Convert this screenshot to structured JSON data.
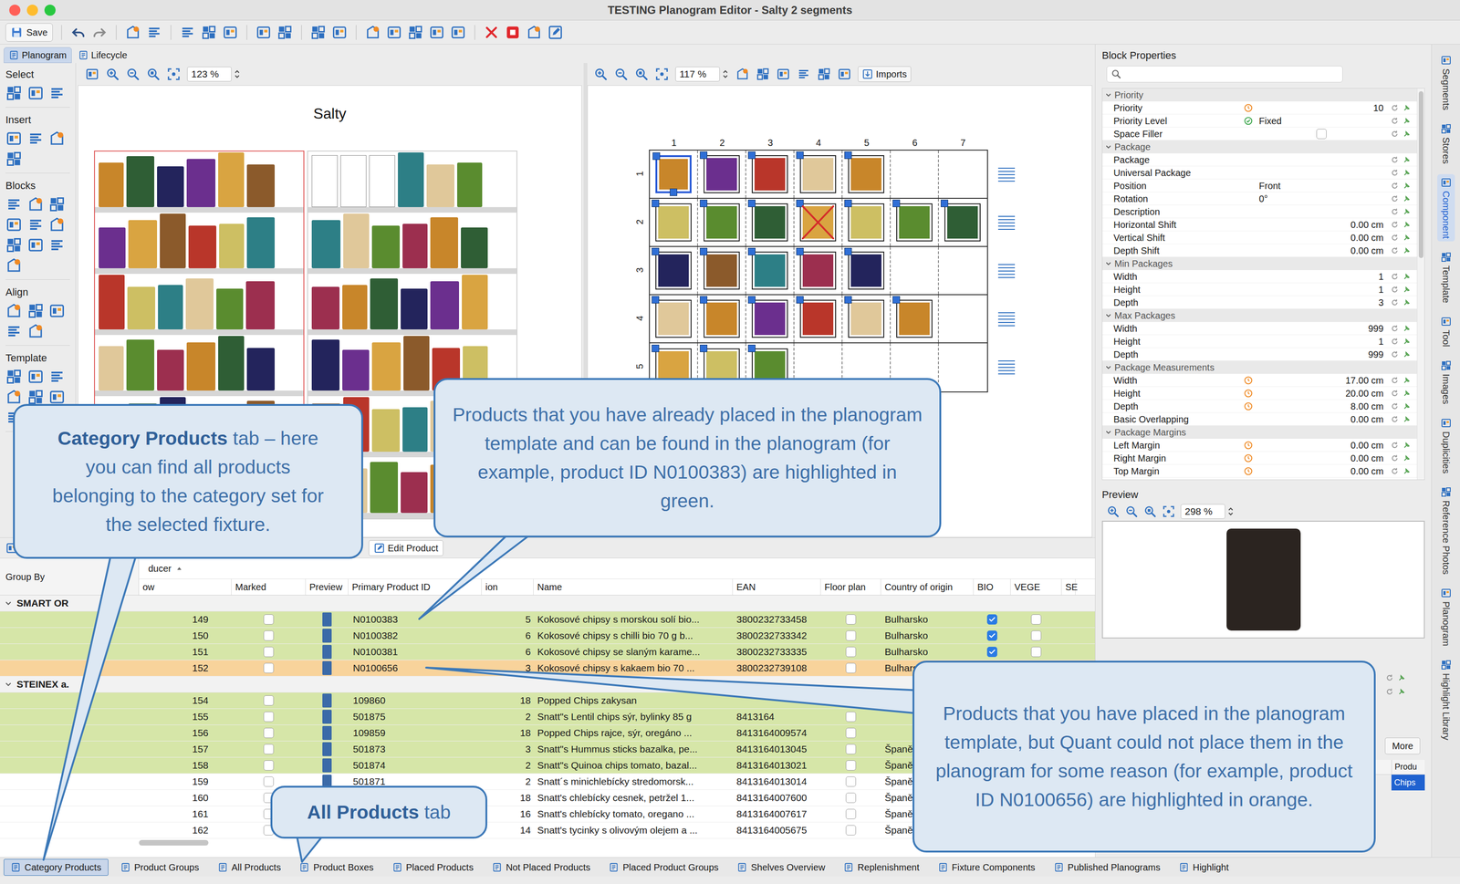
{
  "window": {
    "title": "TESTING Planogram Editor - Salty 2 segments"
  },
  "toolbar": {
    "save": "Save"
  },
  "view_tabs": [
    {
      "label": "Planogram",
      "selected": true
    },
    {
      "label": "Lifecycle",
      "selected": false
    }
  ],
  "palette": [
    "Select",
    "Insert",
    "Blocks",
    "Align",
    "Template"
  ],
  "left_canvas": {
    "zoom": "123 %",
    "title": "Salty"
  },
  "grid_canvas": {
    "zoom": "117 %",
    "imports": "Imports",
    "columns": [
      "1",
      "2",
      "3",
      "4",
      "5",
      "6",
      "7"
    ],
    "rows": [
      {
        "label": "1",
        "cells": [
          {
            "kind": "product",
            "selected": true
          },
          {
            "kind": "product",
            "selected": false
          },
          {
            "kind": "product",
            "selected": false
          },
          {
            "kind": "product",
            "selected": false
          },
          {
            "kind": "product",
            "selected": false
          },
          {
            "kind": "empty",
            "selected": false
          },
          {
            "kind": "empty",
            "selected": false
          }
        ]
      },
      {
        "label": "2",
        "cells": [
          {
            "kind": "product",
            "selected": false
          },
          {
            "kind": "product",
            "selected": false
          },
          {
            "kind": "product",
            "selected": false
          },
          {
            "kind": "crossed",
            "selected": false
          },
          {
            "kind": "product",
            "selected": false
          },
          {
            "kind": "product",
            "selected": false
          },
          {
            "kind": "product",
            "selected": false
          }
        ]
      },
      {
        "label": "3",
        "cells": [
          {
            "kind": "product",
            "selected": false
          },
          {
            "kind": "product",
            "selected": false
          },
          {
            "kind": "product",
            "selected": false
          },
          {
            "kind": "product",
            "selected": false
          },
          {
            "kind": "product",
            "selected": false
          },
          {
            "kind": "empty",
            "selected": false
          },
          {
            "kind": "empty",
            "selected": false
          }
        ]
      },
      {
        "label": "4",
        "cells": [
          {
            "kind": "product",
            "selected": false
          },
          {
            "kind": "product",
            "selected": false
          },
          {
            "kind": "product",
            "selected": false
          },
          {
            "kind": "product",
            "selected": false
          },
          {
            "kind": "product",
            "selected": false
          },
          {
            "kind": "product",
            "selected": false
          },
          {
            "kind": "empty",
            "selected": false
          }
        ]
      },
      {
        "label": "5",
        "cells": [
          {
            "kind": "product",
            "selected": false
          },
          {
            "kind": "product",
            "selected": false
          },
          {
            "kind": "product",
            "selected": false
          },
          {
            "kind": "empty",
            "selected": false
          },
          {
            "kind": "empty",
            "selected": false
          },
          {
            "kind": "empty",
            "selected": false
          },
          {
            "kind": "empty",
            "selected": false
          }
        ]
      }
    ]
  },
  "block_properties": {
    "title": "Block Properties",
    "groups": [
      {
        "label": "Priority",
        "expanded": true,
        "rows": [
          {
            "label": "Priority",
            "kind": "text",
            "value": "10",
            "indicator": "calculated"
          },
          {
            "label": "Priority Level",
            "kind": "text",
            "value": "Fixed",
            "indicator": "fixed"
          },
          {
            "label": "Space Filler",
            "kind": "checkbox",
            "checked": false,
            "indicator": "none"
          }
        ]
      },
      {
        "label": "Package",
        "expanded": true,
        "rows": [
          {
            "label": "Package",
            "kind": "text",
            "value": "",
            "indicator": "none"
          },
          {
            "label": "Universal Package",
            "kind": "text",
            "value": "",
            "indicator": "none"
          },
          {
            "label": "Position",
            "kind": "text",
            "value": "Front",
            "indicator": "none"
          },
          {
            "label": "Rotation",
            "kind": "text",
            "value": "0°",
            "indicator": "none"
          },
          {
            "label": "Description",
            "kind": "text",
            "value": "",
            "indicator": "none"
          },
          {
            "label": "Horizontal Shift",
            "kind": "text",
            "value": "0.00 cm",
            "indicator": "none"
          },
          {
            "label": "Vertical Shift",
            "kind": "text",
            "value": "0.00 cm",
            "indicator": "none"
          },
          {
            "label": "Depth Shift",
            "kind": "text",
            "value": "0.00 cm",
            "indicator": "none"
          }
        ]
      },
      {
        "label": "Min Packages",
        "expanded": true,
        "rows": [
          {
            "label": "Width",
            "kind": "text",
            "value": "1",
            "indicator": "none"
          },
          {
            "label": "Height",
            "kind": "text",
            "value": "1",
            "indicator": "none"
          },
          {
            "label": "Depth",
            "kind": "text",
            "value": "3",
            "indicator": "none"
          }
        ]
      },
      {
        "label": "Max Packages",
        "expanded": true,
        "rows": [
          {
            "label": "Width",
            "kind": "text",
            "value": "999",
            "indicator": "none"
          },
          {
            "label": "Height",
            "kind": "text",
            "value": "1",
            "indicator": "none"
          },
          {
            "label": "Depth",
            "kind": "text",
            "value": "999",
            "indicator": "none"
          }
        ]
      },
      {
        "label": "Package Measurements",
        "expanded": true,
        "rows": [
          {
            "label": "Width",
            "kind": "text",
            "value": "17.00 cm",
            "indicator": "calculated"
          },
          {
            "label": "Height",
            "kind": "text",
            "value": "20.00 cm",
            "indicator": "calculated"
          },
          {
            "label": "Depth",
            "kind": "text",
            "value": "8.00 cm",
            "indicator": "calculated"
          },
          {
            "label": "Basic Overlapping",
            "kind": "text",
            "value": "0.00 cm",
            "indicator": "none"
          }
        ]
      },
      {
        "label": "Package Margins",
        "expanded": true,
        "rows": [
          {
            "label": "Left Margin",
            "kind": "text",
            "value": "0.00 cm",
            "indicator": "calculated"
          },
          {
            "label": "Right Margin",
            "kind": "text",
            "value": "0.00 cm",
            "indicator": "calculated"
          },
          {
            "label": "Top Margin",
            "kind": "text",
            "value": "0.00 cm",
            "indicator": "calculated"
          }
        ]
      }
    ]
  },
  "preview": {
    "title": "Preview",
    "zoom": "298 %"
  },
  "lower_panel": {
    "more": "More",
    "column": "Produ",
    "cell": "Chips",
    "cell_selected": true
  },
  "side_tabs": [
    {
      "label": "Segments",
      "selected": false
    },
    {
      "label": "Stores",
      "selected": false
    },
    {
      "label": "Component",
      "selected": true
    },
    {
      "label": "Template",
      "selected": false
    },
    {
      "label": "Tool",
      "selected": false
    },
    {
      "label": "Images",
      "selected": false
    },
    {
      "label": "Duplicities",
      "selected": false
    },
    {
      "label": "Reference Photos",
      "selected": false
    },
    {
      "label": "Planogram",
      "selected": false
    },
    {
      "label": "Highlight Library",
      "selected": false
    }
  ],
  "table": {
    "edit_button": "Edit Product",
    "group_by": "Group By",
    "sort_column": "ducer",
    "sort_ascending": true,
    "columns": [
      "ow",
      "Marked",
      "Preview",
      "Primary Product ID",
      "ion",
      "Name",
      "EAN",
      "Floor plan",
      "Country of origin",
      "BIO",
      "VEGE",
      "SE"
    ],
    "rows": [
      {
        "kind": "group",
        "label": "SMART OR",
        "expanded": true
      },
      {
        "kind": "item",
        "status": "placed",
        "row": "149",
        "marked": false,
        "primary_id": "N0100383",
        "ion": "5",
        "name": "Kokosové chipsy s morskou solí bio...",
        "ean": "3800232733458",
        "floor_plan": false,
        "country": "Bulharsko",
        "bio": true,
        "vege": false
      },
      {
        "kind": "item",
        "status": "placed",
        "row": "150",
        "marked": false,
        "primary_id": "N0100382",
        "ion": "6",
        "name": "Kokosové chipsy s chilli bio 70 g b...",
        "ean": "3800232733342",
        "floor_plan": false,
        "country": "Bulharsko",
        "bio": true,
        "vege": false
      },
      {
        "kind": "item",
        "status": "placed",
        "row": "151",
        "marked": false,
        "primary_id": "N0100381",
        "ion": "6",
        "name": "Kokosové chipsy se slaným karame...",
        "ean": "3800232733335",
        "floor_plan": false,
        "country": "Bulharsko",
        "bio": true,
        "vege": false
      },
      {
        "kind": "item",
        "status": "not_placed",
        "row": "152",
        "marked": false,
        "primary_id": "N0100656",
        "ion": "3",
        "name": "Kokosové chipsy s kakaem bio 70 ...",
        "ean": "3800232739108",
        "floor_plan": false,
        "country": "Bulhars",
        "bio": true,
        "vege": false
      },
      {
        "kind": "group",
        "label": "STEINEX a.",
        "expanded": true
      },
      {
        "kind": "item",
        "status": "placed",
        "row": "154",
        "marked": false,
        "primary_id": "109860",
        "ion": "18",
        "name": "Popped Chips zakysan",
        "ean": "",
        "floor_plan": false,
        "country": "",
        "bio": false,
        "vege": false
      },
      {
        "kind": "item",
        "status": "placed",
        "row": "155",
        "marked": false,
        "primary_id": "501875",
        "ion": "2",
        "name": "Snatt\"s Lentil chips sýr, bylinky 85 g",
        "ean": "8413164",
        "floor_plan": false,
        "country": "",
        "bio": false,
        "vege": false
      },
      {
        "kind": "item",
        "status": "placed",
        "row": "156",
        "marked": false,
        "primary_id": "109859",
        "ion": "18",
        "name": "Popped Chips rajce, sýr, oregáno ...",
        "ean": "8413164009574",
        "floor_plan": false,
        "country": "",
        "bio": false,
        "vege": false
      },
      {
        "kind": "item",
        "status": "placed",
        "row": "157",
        "marked": false,
        "primary_id": "501873",
        "ion": "3",
        "name": "Snatt\"s Hummus sticks bazalka, pe...",
        "ean": "8413164013045",
        "floor_plan": false,
        "country": "Španěl",
        "bio": false,
        "vege": false
      },
      {
        "kind": "item",
        "status": "placed",
        "row": "158",
        "marked": false,
        "primary_id": "501874",
        "ion": "2",
        "name": "Snatt\"s Quinoa chips tomato, bazal...",
        "ean": "8413164013021",
        "floor_plan": false,
        "country": "Španěl",
        "bio": false,
        "vege": false
      },
      {
        "kind": "item",
        "status": "none",
        "row": "159",
        "marked": false,
        "primary_id": "501871",
        "ion": "2",
        "name": "Snatt´s minichlebícky stredomorsk...",
        "ean": "8413164013014",
        "floor_plan": false,
        "country": "Španěl",
        "bio": false,
        "vege": false
      },
      {
        "kind": "item",
        "status": "none",
        "row": "160",
        "marked": false,
        "primary_id": "",
        "ion": "18",
        "name": "Snatt's chlebícky cesnek, petržel 1...",
        "ean": "8413164007600",
        "floor_plan": false,
        "country": "Španěl",
        "bio": false,
        "vege": false
      },
      {
        "kind": "item",
        "status": "none",
        "row": "161",
        "marked": false,
        "primary_id": "",
        "ion": "16",
        "name": "Snatt's chlebícky tomato, oregano ...",
        "ean": "8413164007617",
        "floor_plan": false,
        "country": "Španěl",
        "bio": false,
        "vege": false
      },
      {
        "kind": "item",
        "status": "none",
        "row": "162",
        "marked": false,
        "primary_id": "",
        "ion": "14",
        "name": "Snatt's tycinky s olivovým olejem a ...",
        "ean": "8413164005675",
        "floor_plan": false,
        "country": "Španěl",
        "bio": false,
        "vege": false
      }
    ]
  },
  "bottom_tabs": [
    {
      "label": "Category Products",
      "selected": true
    },
    {
      "label": "Product Groups",
      "selected": false
    },
    {
      "label": "All Products",
      "selected": false
    },
    {
      "label": "Product Boxes",
      "selected": false
    },
    {
      "label": "Placed Products",
      "selected": false
    },
    {
      "label": "Not Placed Products",
      "selected": false
    },
    {
      "label": "Placed Product Groups",
      "selected": false
    },
    {
      "label": "Shelves Overview",
      "selected": false
    },
    {
      "label": "Replenishment",
      "selected": false
    },
    {
      "label": "Fixture Components",
      "selected": false
    },
    {
      "label": "Published Planograms",
      "selected": false
    },
    {
      "label": "Highlight",
      "selected": false
    }
  ],
  "callouts": [
    {
      "bold": "Category Products",
      "text": " tab – here you can find all products belonging to the category set for the selected fixture."
    },
    {
      "bold": "",
      "text": "Products that you have already placed in the planogram template and can be found in the planogram (for example, product ID N0100383) are highlighted in green."
    },
    {
      "bold": "",
      "text": "Products that you have placed in the planogram template, but Quant could not place them in the planogram for some reason (for example, product ID N0100656) are highlighted in orange."
    },
    {
      "bold": "All Products",
      "text": " tab"
    }
  ]
}
